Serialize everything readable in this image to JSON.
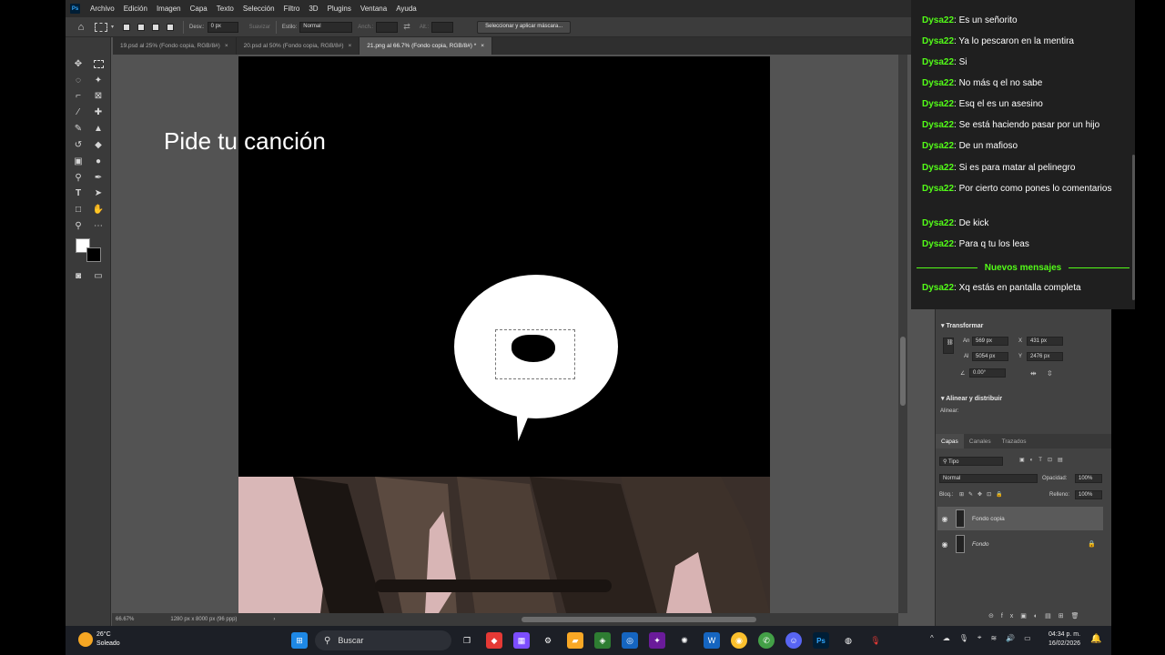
{
  "menubar": {
    "items": [
      "Archivo",
      "Edición",
      "Imagen",
      "Capa",
      "Texto",
      "Selección",
      "Filtro",
      "3D",
      "Plugins",
      "Ventana",
      "Ayuda"
    ]
  },
  "optionsbar": {
    "desv_label": "Desv.:",
    "desv_value": "0 px",
    "suavizar_label": "Suavizar",
    "estilo_label": "Estilo:",
    "estilo_value": "Normal",
    "anch_label": "Anch.:",
    "alt_label": "Alt.:",
    "mask_button": "Seleccionar y aplicar máscara..."
  },
  "tabs": [
    {
      "label": "19.psd al 25% (Fondo copia, RGB/8#)"
    },
    {
      "label": "20.psd al 50% (Fondo copia, RGB/8#)"
    },
    {
      "label": "21.png al 66.7% (Fondo copia, RGB/8#) *"
    }
  ],
  "overlay_title": "Pide tu canción",
  "statusbar": {
    "zoom": "66.67%",
    "doc_size": "1280 px x 8000 px (96 ppp)"
  },
  "properties": {
    "transform_title": "Transformar",
    "an_label": "An",
    "an_value": "569 px",
    "x_label": "X",
    "x_value": "431 px",
    "al_label": "Al",
    "al_value": "5054 px",
    "y_label": "Y",
    "y_value": "2476 px",
    "angle_value": "0.00°",
    "align_title": "Alinear y distribuir",
    "align_label": "Alinear:"
  },
  "layers_panel": {
    "tabs": [
      "Capas",
      "Canales",
      "Trazados"
    ],
    "filter": "Tipo",
    "blend_mode": "Normal",
    "opacity_label": "Opacidad:",
    "opacity_value": "100%",
    "lock_label": "Bloq.:",
    "fill_label": "Relleno:",
    "fill_value": "100%",
    "layers": [
      {
        "name": "Fondo copia"
      },
      {
        "name": "Fondo"
      }
    ]
  },
  "chat": {
    "messages": [
      {
        "user": "Dysa22",
        "text": ": Es un señorito"
      },
      {
        "user": "Dysa22",
        "text": ": Ya lo pescaron en la mentira"
      },
      {
        "user": "Dysa22",
        "text": ": Si"
      },
      {
        "user": "Dysa22",
        "text": ": No más q el no sabe"
      },
      {
        "user": "Dysa22",
        "text": ": Esq el es un asesino"
      },
      {
        "user": "Dysa22",
        "text": ": Se está haciendo pasar por un hijo"
      },
      {
        "user": "Dysa22",
        "text": ": De un mafioso"
      },
      {
        "user": "Dysa22",
        "text": ": Si es para matar al pelinegro"
      },
      {
        "user": "Dysa22",
        "text": ": Por cierto como pones lo comentarios"
      },
      {
        "user": "Dysa22",
        "text": ": De kick"
      },
      {
        "user": "Dysa22",
        "text": ": Para q tu los leas"
      }
    ],
    "new_messages_label": "Nuevos mensajes",
    "new_message": {
      "user": "Dysa22",
      "text": ": Xq estás en pantalla completa"
    }
  },
  "taskbar": {
    "temperature": "26°C",
    "weather": "Soleado",
    "search_placeholder": "Buscar",
    "time": "04:34 p. m.",
    "date": "16/02/2026"
  },
  "colors": {
    "chat_username": "#53fc18",
    "ps_background": "#535353"
  }
}
